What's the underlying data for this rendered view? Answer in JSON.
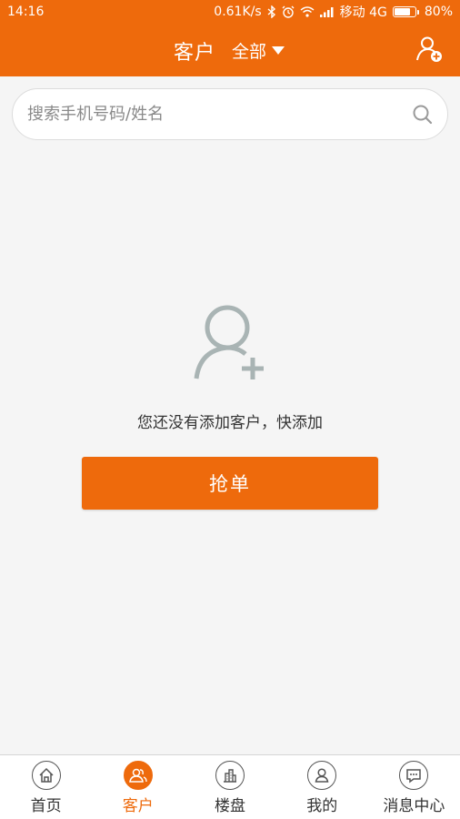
{
  "status_bar": {
    "time": "14:16",
    "speed": "0.61K/s",
    "carrier": "移动 4G",
    "battery": "80%",
    "battery_level": 0.8
  },
  "header": {
    "title": "客户",
    "filter_label": "全部",
    "add_icon": "add-user-icon"
  },
  "search": {
    "placeholder": "搜索手机号码/姓名",
    "icon": "search-icon"
  },
  "empty_state": {
    "icon": "add-user-icon",
    "message": "您还没有添加客户，快添加",
    "button_label": "抢单"
  },
  "tabs": [
    {
      "label": "首页",
      "icon": "home-icon",
      "active": false
    },
    {
      "label": "客户",
      "icon": "customers-icon",
      "active": true
    },
    {
      "label": "楼盘",
      "icon": "building-icon",
      "active": false
    },
    {
      "label": "我的",
      "icon": "profile-icon",
      "active": false
    },
    {
      "label": "消息中心",
      "icon": "message-icon",
      "active": false
    }
  ],
  "colors": {
    "accent": "#ee6a0c",
    "icon_gray": "#a9b4b4",
    "background": "#f5f5f5"
  }
}
